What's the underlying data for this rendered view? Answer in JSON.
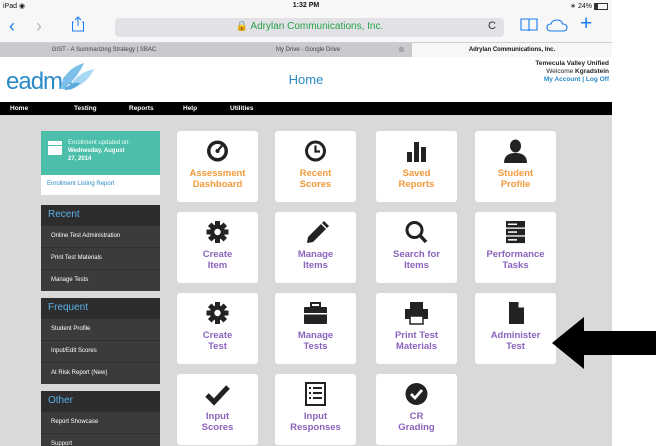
{
  "status_bar": {
    "device": "iPad",
    "wifi": "◉",
    "time": "1:32 PM",
    "battery": "24%"
  },
  "browser": {
    "back": "‹",
    "forward": "›",
    "url": "🔒 Adrylan Communications, Inc.",
    "reload": "C",
    "tabs": [
      "GIST - A Summarizing Strategy | SBAC",
      "My Drive - Google Drive",
      "Adrylan Communications, Inc."
    ],
    "tab_close": "⊗"
  },
  "header": {
    "logo": "eadms",
    "title": "Home",
    "district": "Temecula Valley Unified",
    "welcome_prefix": "Welcome ",
    "username": "Kgradstein",
    "links": "My Account | Log Off"
  },
  "menu": [
    "Home",
    "Testing",
    "Reports",
    "Help",
    "Utilities"
  ],
  "sidebar": {
    "enrollment": {
      "label": "Enrollment updated on:",
      "date_line1": "Wednesday, August",
      "date_line2": "27, 2014",
      "link": "Enrollment Listing Report"
    },
    "recent": {
      "title": "Recent",
      "items": [
        "Online Test Administration",
        "Print Test Materials",
        "Manage Tests"
      ]
    },
    "frequent": {
      "title": "Frequent",
      "items": [
        "Student Profile",
        "Input/Edit Scores",
        "At Risk Report (New)"
      ]
    },
    "other": {
      "title": "Other",
      "items": [
        "Report Showcase",
        "Support"
      ]
    }
  },
  "tiles": [
    {
      "l1": "Assessment",
      "l2": "Dashboard",
      "icon": "dashboard-icon",
      "color": "orange"
    },
    {
      "l1": "Recent",
      "l2": "Scores",
      "icon": "clock-icon",
      "color": "orange"
    },
    {
      "l1": "Saved",
      "l2": "Reports",
      "icon": "bar-chart-icon",
      "color": "orange"
    },
    {
      "l1": "Student",
      "l2": "Profile",
      "icon": "user-icon",
      "color": "orange"
    },
    {
      "l1": "Create",
      "l2": "Item",
      "icon": "gear-icon",
      "color": "purple"
    },
    {
      "l1": "Manage",
      "l2": "Items",
      "icon": "pencil-icon",
      "color": "purple"
    },
    {
      "l1": "Search for",
      "l2": "Items",
      "icon": "search-icon",
      "color": "purple"
    },
    {
      "l1": "Performance",
      "l2": "Tasks",
      "icon": "server-icon",
      "color": "purple"
    },
    {
      "l1": "Create",
      "l2": "Test",
      "icon": "gear-icon",
      "color": "purple"
    },
    {
      "l1": "Manage",
      "l2": "Tests",
      "icon": "briefcase-icon",
      "color": "purple"
    },
    {
      "l1": "Print Test",
      "l2": "Materials",
      "icon": "printer-icon",
      "color": "purple"
    },
    {
      "l1": "Administer",
      "l2": "Test",
      "icon": "document-icon",
      "color": "purple"
    },
    {
      "l1": "Input",
      "l2": "Scores",
      "icon": "checkmark-icon",
      "color": "purple"
    },
    {
      "l1": "Input",
      "l2": "Responses",
      "icon": "list-icon",
      "color": "purple"
    },
    {
      "l1": "CR",
      "l2": "Grading",
      "icon": "check-circle-icon",
      "color": "purple"
    }
  ],
  "colors": {
    "accent": "#2a8bc7",
    "orange": "#f29a3b",
    "purple": "#8b63bd",
    "teal": "#4bbfa9"
  }
}
